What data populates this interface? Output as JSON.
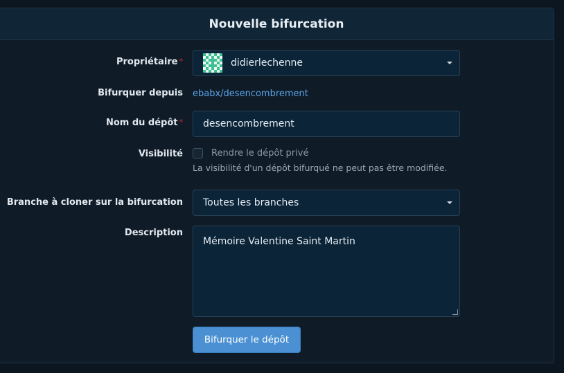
{
  "header": {
    "title": "Nouvelle bifurcation"
  },
  "form": {
    "owner": {
      "label": "Propriétaire",
      "required_mark": "*",
      "value": "didierlechenne",
      "avatar_icon": "identicon-avatar"
    },
    "fork_from": {
      "label": "Bifurquer depuis",
      "link_text": "ebabx/desencombrement"
    },
    "repo_name": {
      "label": "Nom du dépôt",
      "required_mark": "*",
      "value": "desencombrement"
    },
    "visibility": {
      "label": "Visibilité",
      "checkbox_label": "Rendre le dépôt privé",
      "checked": false,
      "help": "La visibilité d'un dépôt bifurqué ne peut pas être modifiée."
    },
    "branch": {
      "label": "Branche à cloner sur la bifurcation",
      "value": "Toutes les branches"
    },
    "description": {
      "label": "Description",
      "value": "Mémoire Valentine Saint Martin"
    },
    "submit_label": "Bifurquer le dépôt"
  },
  "colors": {
    "accent": "#4a90d2",
    "link": "#5aa3e6",
    "required": "#db2828",
    "background": "#0b1620"
  }
}
